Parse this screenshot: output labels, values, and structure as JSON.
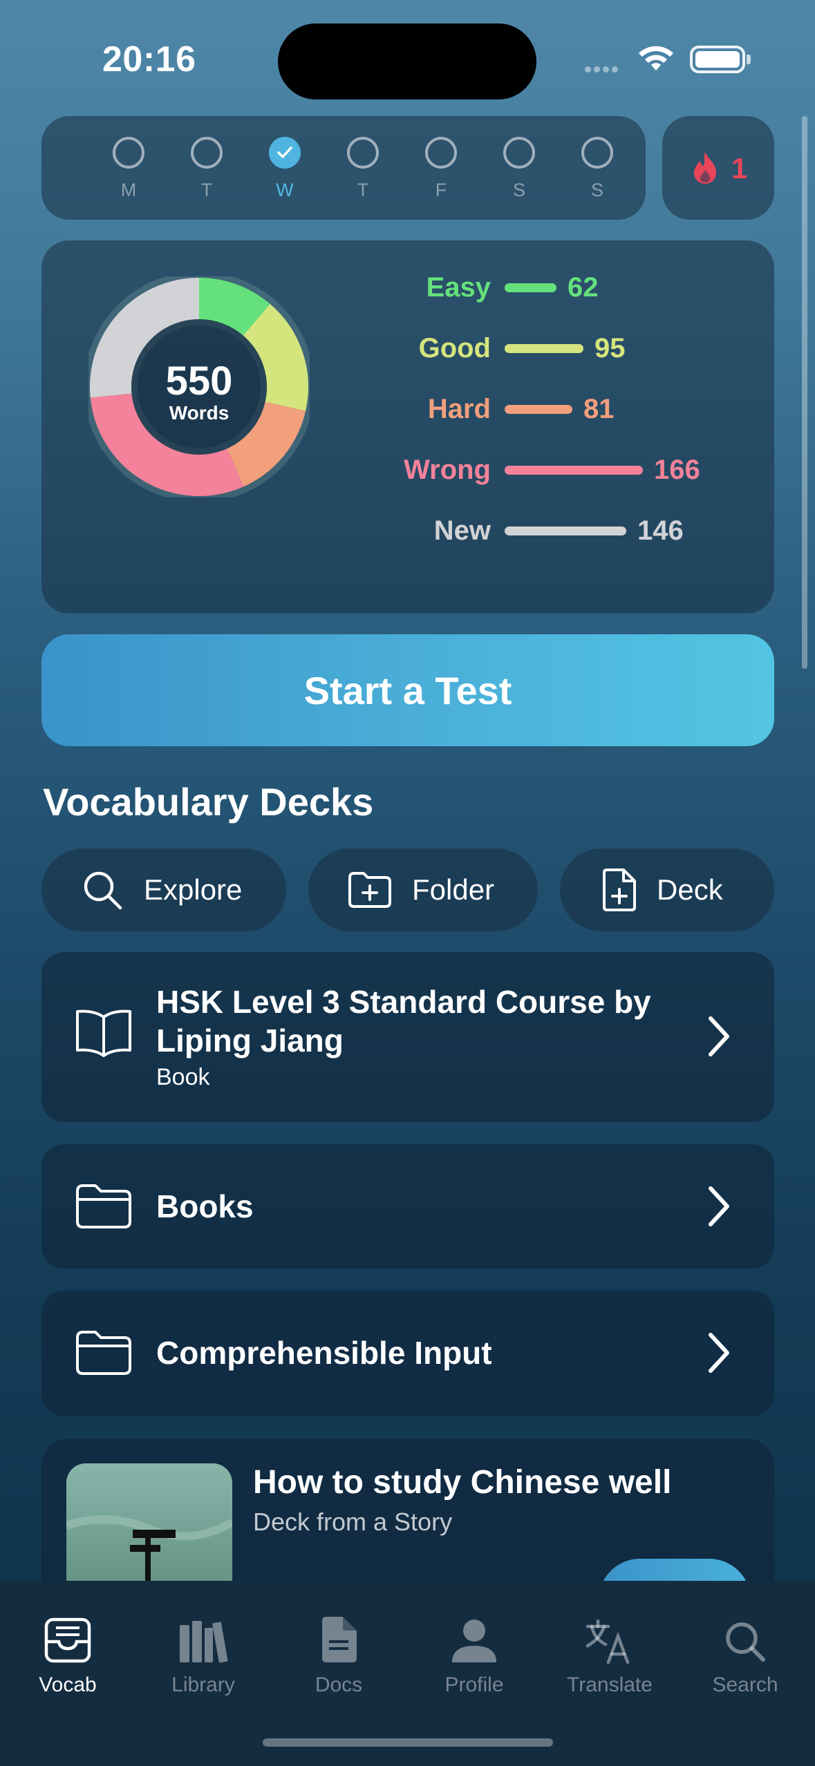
{
  "status_bar": {
    "time": "20:16"
  },
  "week": {
    "days": [
      {
        "label": "M",
        "done": false,
        "today": false
      },
      {
        "label": "T",
        "done": false,
        "today": false
      },
      {
        "label": "W",
        "done": true,
        "today": true
      },
      {
        "label": "T",
        "done": false,
        "today": false
      },
      {
        "label": "F",
        "done": false,
        "today": false
      },
      {
        "label": "S",
        "done": false,
        "today": false
      },
      {
        "label": "S",
        "done": false,
        "today": false
      }
    ],
    "streak": "1"
  },
  "stats": {
    "total": "550",
    "total_label": "Words",
    "items": [
      {
        "label": "Easy",
        "value": "62",
        "color": "#64e17c"
      },
      {
        "label": "Good",
        "value": "95",
        "color": "#d5e57d"
      },
      {
        "label": "Hard",
        "value": "81",
        "color": "#f29f7c"
      },
      {
        "label": "Wrong",
        "value": "166",
        "color": "#f3829a"
      },
      {
        "label": "New",
        "value": "146",
        "color": "#d2d3d6"
      }
    ]
  },
  "start_button": "Start a Test",
  "decks": {
    "title": "Vocabulary Decks",
    "actions": [
      {
        "label": "Explore",
        "icon": "search-icon"
      },
      {
        "label": "Folder",
        "icon": "folder-plus-icon"
      },
      {
        "label": "Deck",
        "icon": "document-plus-icon"
      }
    ],
    "items": [
      {
        "title_line1": "HSK Level 3 Standard Course by",
        "title_line2": "Liping Jiang",
        "subtitle": "Book",
        "icon": "book-icon"
      },
      {
        "title": "Books",
        "icon": "folder-icon"
      },
      {
        "title": "Comprehensible Input",
        "icon": "folder-icon"
      }
    ],
    "story": {
      "title": "How to study Chinese well",
      "subtitle": "Deck from a Story"
    }
  },
  "tabs": [
    {
      "label": "Vocab",
      "icon": "vocab-tray-icon",
      "active": true
    },
    {
      "label": "Library",
      "icon": "library-books-icon",
      "active": false
    },
    {
      "label": "Docs",
      "icon": "document-icon",
      "active": false
    },
    {
      "label": "Profile",
      "icon": "person-icon",
      "active": false
    },
    {
      "label": "Translate",
      "icon": "translate-icon",
      "active": false
    },
    {
      "label": "Search",
      "icon": "search-icon",
      "active": false
    }
  ]
}
